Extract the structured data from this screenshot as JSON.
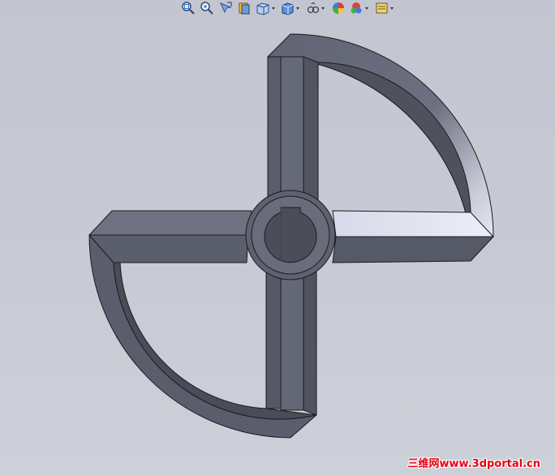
{
  "toolbar": {
    "buttons": [
      {
        "id": "zoom-to-fit",
        "icon": "zoom-fit-icon",
        "has_dropdown": false
      },
      {
        "id": "zoom-to-area",
        "icon": "zoom-area-icon",
        "has_dropdown": false
      },
      {
        "id": "previous-view",
        "icon": "previous-view-icon",
        "has_dropdown": false
      },
      {
        "id": "section-view",
        "icon": "section-view-icon",
        "has_dropdown": false
      },
      {
        "id": "view-orientation",
        "icon": "view-orientation-icon",
        "has_dropdown": true
      },
      {
        "id": "display-style",
        "icon": "display-style-icon",
        "has_dropdown": true
      },
      {
        "id": "hide-show-items",
        "icon": "hide-show-icon",
        "has_dropdown": true
      },
      {
        "id": "edit-appearance",
        "icon": "appearance-icon",
        "has_dropdown": false
      },
      {
        "id": "apply-scene",
        "icon": "scene-icon",
        "has_dropdown": true
      },
      {
        "id": "view-settings",
        "icon": "view-settings-icon",
        "has_dropdown": true
      }
    ]
  },
  "model": {
    "name": "agitator-blade-part",
    "colors": {
      "face_dark": "#4f525d",
      "face_mid": "#5e6270",
      "face_light": "#6d7180",
      "face_highlight": "#dde0ee",
      "edge": "#1a1b20"
    }
  },
  "watermark": {
    "text": "三维网www.3dportal.cn",
    "color": "#e60012"
  }
}
